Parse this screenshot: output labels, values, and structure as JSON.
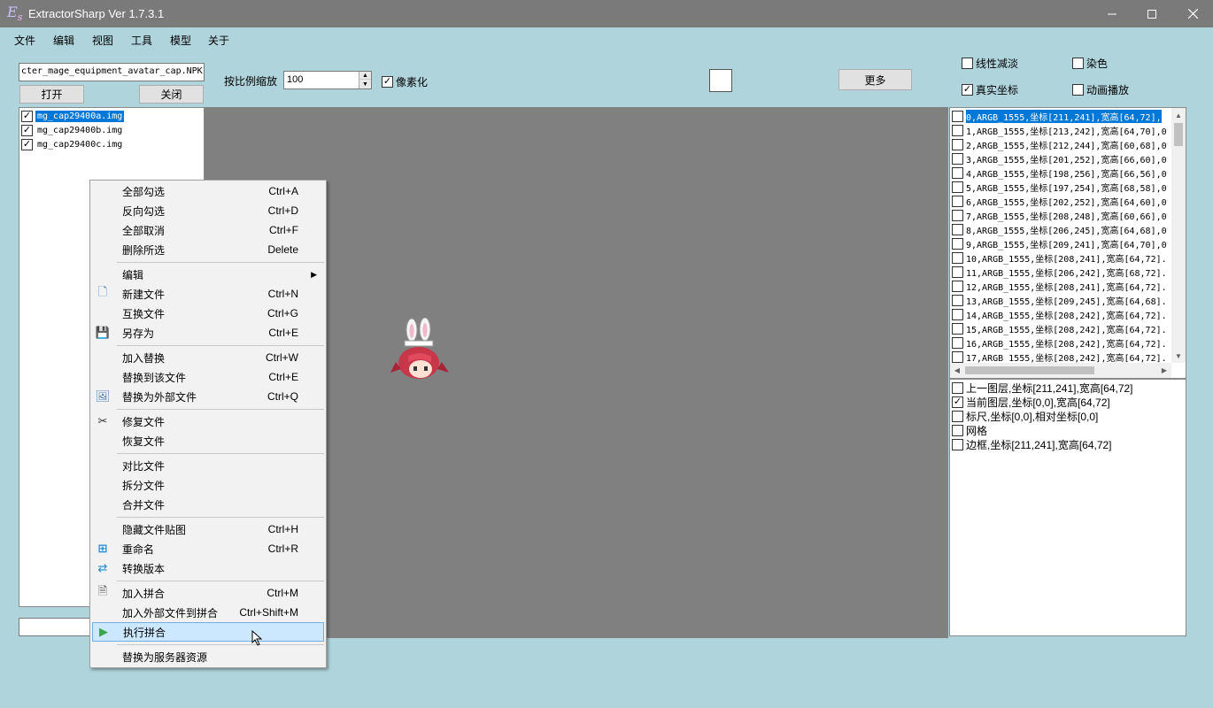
{
  "window": {
    "logo": "Es",
    "title": "ExtractorSharp Ver 1.7.3.1",
    "controls": [
      "minimize",
      "maximize",
      "close"
    ]
  },
  "menubar": [
    "文件",
    "编辑",
    "视图",
    "工具",
    "模型",
    "关于"
  ],
  "toolbar": {
    "npk_path": "cter_mage_equipment_avatar_cap.NPK",
    "open_label": "打开",
    "close_label": "关闭",
    "scale_label": "按比例缩放",
    "scale_value": "100",
    "pixelate_label": "像素化",
    "pixelate_checked": true,
    "more_label": "更多",
    "linear_fade_label": "线性减淡",
    "linear_fade_checked": false,
    "dye_label": "染色",
    "dye_checked": false,
    "real_coord_label": "真实坐标",
    "real_coord_checked": true,
    "animate_label": "动画播放",
    "animate_checked": false
  },
  "files": [
    {
      "name": "mg_cap29400a.img",
      "checked": true,
      "selected": true
    },
    {
      "name": "mg_cap29400b.img",
      "checked": true,
      "selected": false
    },
    {
      "name": "mg_cap29400c.img",
      "checked": true,
      "selected": false
    }
  ],
  "frames": [
    "0,ARGB_1555,坐标[211,241],宽高[64,72],",
    "1,ARGB_1555,坐标[213,242],宽高[64,70],0",
    "2,ARGB_1555,坐标[212,244],宽高[60,68],0",
    "3,ARGB_1555,坐标[201,252],宽高[66,60],0",
    "4,ARGB_1555,坐标[198,256],宽高[66,56],0",
    "5,ARGB_1555,坐标[197,254],宽高[68,58],0",
    "6,ARGB_1555,坐标[202,252],宽高[64,60],0",
    "7,ARGB_1555,坐标[208,248],宽高[60,66],0",
    "8,ARGB_1555,坐标[206,245],宽高[64,68],0",
    "9,ARGB_1555,坐标[209,241],宽高[64,70],0",
    "10,ARGB_1555,坐标[208,241],宽高[64,72].",
    "11,ARGB_1555,坐标[206,242],宽高[68,72].",
    "12,ARGB_1555,坐标[208,241],宽高[64,72].",
    "13,ARGB_1555,坐标[209,245],宽高[64,68].",
    "14,ARGB_1555,坐标[208,242],宽高[64,72].",
    "15,ARGB_1555,坐标[208,242],宽高[64,72].",
    "16,ARGB_1555,坐标[208,242],宽高[64,72].",
    "17,ARGB_1555,坐标[208,242],宽高[64,72]."
  ],
  "layers": [
    {
      "label": "上一图层,坐标[211,241],宽高[64,72]",
      "checked": false
    },
    {
      "label": "当前图层,坐标[0,0],宽高[64,72]",
      "checked": true
    },
    {
      "label": "标尺,坐标[0,0],相对坐标[0,0]",
      "checked": false
    },
    {
      "label": "网格",
      "checked": false
    },
    {
      "label": "边框,坐标[211,241],宽高[64,72]",
      "checked": false
    }
  ],
  "context_menu": [
    {
      "label": "全部勾选",
      "shortcut": "Ctrl+A"
    },
    {
      "label": "反向勾选",
      "shortcut": "Ctrl+D"
    },
    {
      "label": "全部取消",
      "shortcut": "Ctrl+F"
    },
    {
      "label": "删除所选",
      "shortcut": "Delete"
    },
    {
      "separator": true
    },
    {
      "label": "编辑",
      "shortcut": "",
      "submenu": true
    },
    {
      "label": "新建文件",
      "shortcut": "Ctrl+N",
      "icon": "new-file-icon"
    },
    {
      "label": "互换文件",
      "shortcut": "Ctrl+G"
    },
    {
      "label": "另存为",
      "shortcut": "Ctrl+E",
      "icon": "save-icon"
    },
    {
      "separator": true
    },
    {
      "label": "加入替换",
      "shortcut": "Ctrl+W"
    },
    {
      "label": "替换到该文件",
      "shortcut": "Ctrl+E"
    },
    {
      "label": "替换为外部文件",
      "shortcut": "Ctrl+Q",
      "icon": "image-replace-icon"
    },
    {
      "separator": true
    },
    {
      "label": "修复文件",
      "shortcut": "",
      "icon": "wrench-icon"
    },
    {
      "label": "恢复文件",
      "shortcut": ""
    },
    {
      "separator": true
    },
    {
      "label": "对比文件",
      "shortcut": ""
    },
    {
      "label": "拆分文件",
      "shortcut": ""
    },
    {
      "label": "合并文件",
      "shortcut": ""
    },
    {
      "separator": true
    },
    {
      "label": "隐藏文件贴图",
      "shortcut": "Ctrl+H"
    },
    {
      "label": "重命名",
      "shortcut": "Ctrl+R",
      "icon": "rename-icon"
    },
    {
      "label": "转换版本",
      "shortcut": "",
      "icon": "convert-icon"
    },
    {
      "separator": true
    },
    {
      "label": "加入拼合",
      "shortcut": "Ctrl+M",
      "icon": "merge-add-icon"
    },
    {
      "label": "加入外部文件到拼合",
      "shortcut": "Ctrl+Shift+M"
    },
    {
      "label": "执行拼合",
      "shortcut": "",
      "icon": "play-icon",
      "highlighted": true
    },
    {
      "separator": true
    },
    {
      "label": "替换为服务器资源",
      "shortcut": ""
    }
  ]
}
